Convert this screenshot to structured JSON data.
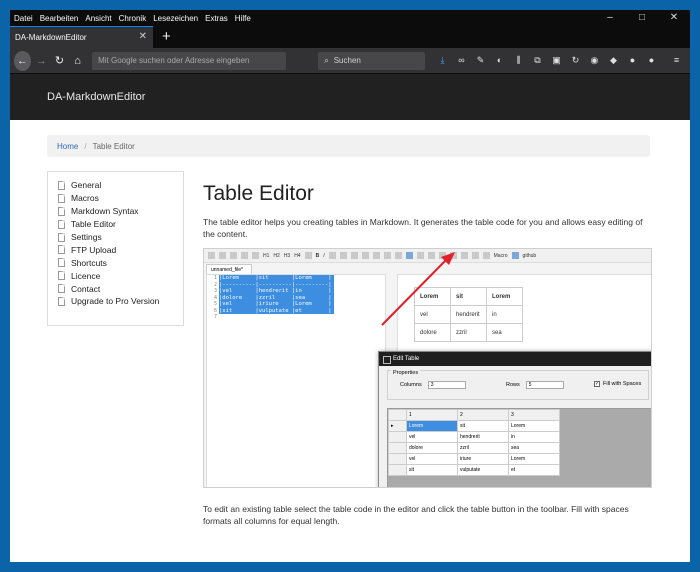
{
  "menu": [
    "Datei",
    "Bearbeiten",
    "Ansicht",
    "Chronik",
    "Lesezeichen",
    "Extras",
    "Hilfe"
  ],
  "window_controls": [
    "–",
    "□",
    "✕"
  ],
  "tab": {
    "title": "DA-MarkdownEditor",
    "close": "✕",
    "new": "+"
  },
  "nav": {
    "url_placeholder": "Mit Google suchen oder Adresse eingeben",
    "search_placeholder": "Suchen",
    "back": "←",
    "forward": "→",
    "reload": "↻",
    "home": "⌂"
  },
  "toolbar_icons": [
    "download-icon",
    "mask-icon",
    "wrench-icon",
    "palette-icon",
    "library-icon",
    "sync-icon",
    "sidebar-icon",
    "extension-icons",
    "menu-icon"
  ],
  "site": {
    "brand": "DA-MarkdownEditor"
  },
  "breadcrumb": {
    "home": "Home",
    "separator": "/",
    "current": "Table Editor"
  },
  "sidebar": {
    "items": [
      {
        "label": "General"
      },
      {
        "label": "Macros"
      },
      {
        "label": "Markdown Syntax"
      },
      {
        "label": "Table Editor"
      },
      {
        "label": "Settings"
      },
      {
        "label": "FTP Upload"
      },
      {
        "label": "Shortcuts"
      },
      {
        "label": "Licence"
      },
      {
        "label": "Contact"
      },
      {
        "label": "Upgrade to Pro Version"
      }
    ]
  },
  "main": {
    "title": "Table Editor",
    "intro": "The table editor helps you creating tables in Markdown. It generates the table code for you and allows easy editing of the content.",
    "outro": "To edit an existing table select the table code in the editor and click the table button in the toolbar. Fill with spaces formats all columns for equal length."
  },
  "screenshot": {
    "toolbar": [
      "H1",
      "H2",
      "H3",
      "H4",
      "B",
      "I",
      "Macro",
      "github"
    ],
    "file_tab": "unnamed_file*",
    "line_numbers": [
      "1",
      "2",
      "3",
      "4",
      "5",
      "6",
      "7"
    ],
    "code_lines": [
      "|Lorem     |sit       |Lorem     |",
      "|----------|----------|----------|",
      "|vel       |hendrerit |in        |",
      "|dolore    |zzril     |sea       |",
      "|vel       |iriure    |Lorem     |",
      "|sit       |vulputate |et        |"
    ],
    "preview_rows": [
      [
        "Lorem",
        "sit",
        "Lorem"
      ],
      [
        "vel",
        "hendrerit",
        "in"
      ],
      [
        "dolore",
        "zzril",
        "sea"
      ]
    ],
    "dialog": {
      "title": "Edit Table",
      "group": "Properties",
      "columns_label": "Columns",
      "columns_value": "3",
      "rows_label": "Rows",
      "rows_value": "5",
      "fill_label": "Fill with Spaces",
      "fill_checked": "✓",
      "headers": [
        "1",
        "2",
        "3"
      ],
      "rows": [
        [
          "Lorem",
          "sit",
          "Lorem"
        ],
        [
          "vel",
          "hendrerit",
          "in"
        ],
        [
          "dolore",
          "zzril",
          "sea"
        ],
        [
          "vel",
          "iriure",
          "Lorem"
        ],
        [
          "sit",
          "vulputate",
          "et"
        ]
      ]
    }
  },
  "colors": {
    "os_accent": "#0b63a8",
    "browser_chrome": "#323234",
    "site_nav": "#212121",
    "link": "#2a6bbf",
    "selection": "#3d8ee0",
    "arrow": "#e0202a"
  }
}
